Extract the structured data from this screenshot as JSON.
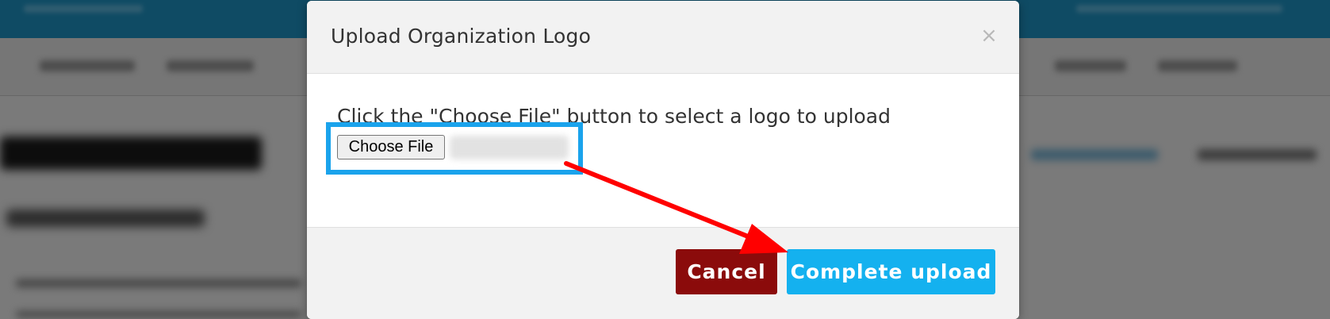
{
  "dialog": {
    "title": "Upload Organization Logo",
    "close_glyph": "×"
  },
  "body": {
    "instructions": "Click the \"Choose File\" button to select a logo to upload",
    "choose_file_label": "Choose File"
  },
  "footer": {
    "cancel_label": "Cancel",
    "complete_label": "Complete upload"
  },
  "colors": {
    "highlight_box": "#1aa3ec",
    "annotation_arrow": "#ff0000",
    "cancel_button": "#8b0b0b",
    "complete_button": "#14b1ef"
  },
  "icons": {
    "close": "close-icon",
    "annotation": "arrow-annotation-icon"
  }
}
